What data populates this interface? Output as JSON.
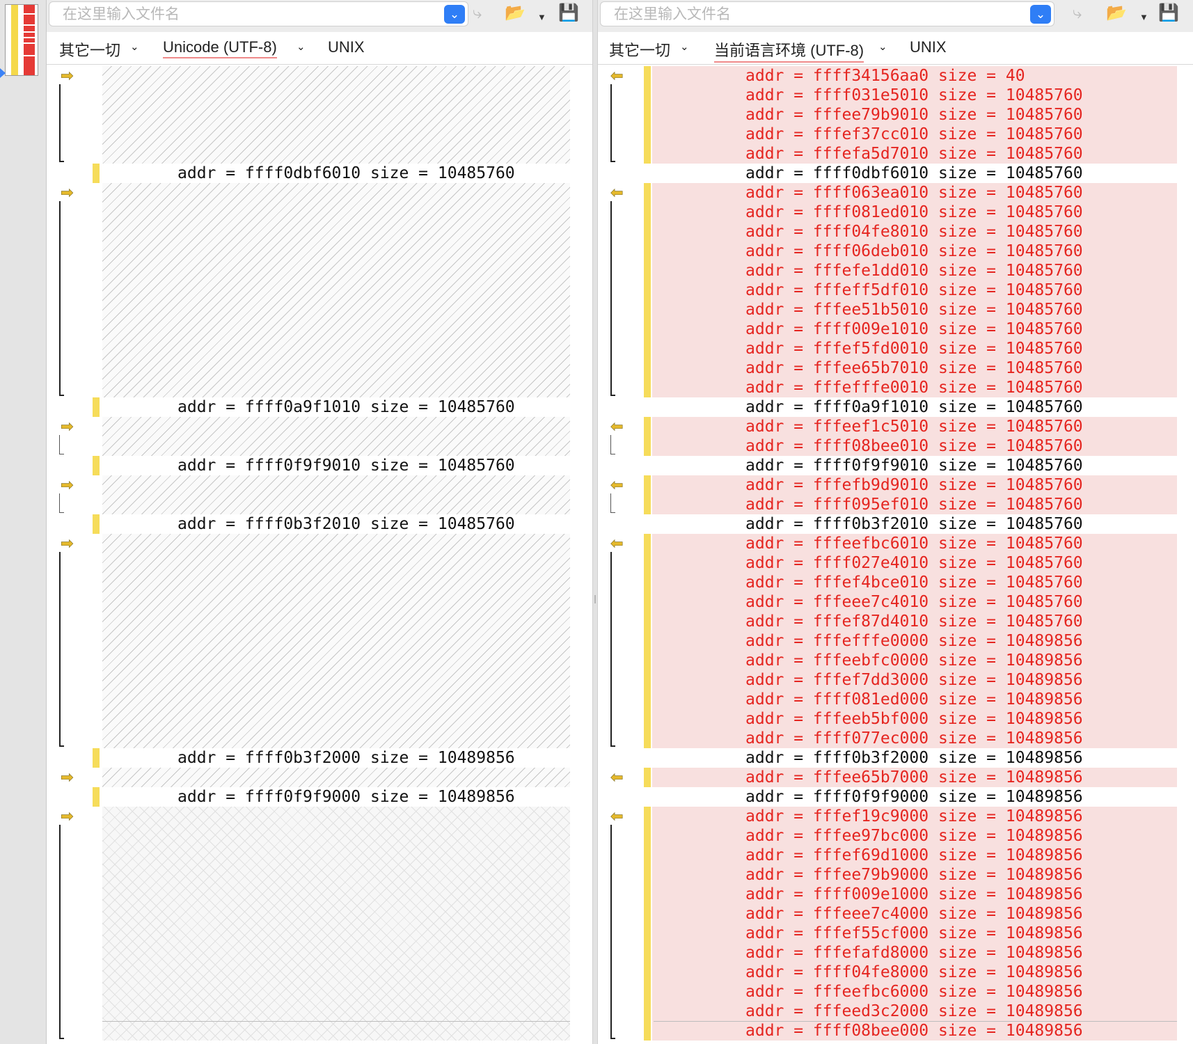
{
  "overview": {
    "label": "diff-overview"
  },
  "left": {
    "filename_placeholder": "在这里输入文件名",
    "info": {
      "file_type": "其它一切",
      "encoding": "Unicode (UTF-8)",
      "line_endings": "UNIX"
    }
  },
  "right": {
    "filename_placeholder": "在这里输入文件名",
    "info": {
      "file_type": "其它一切",
      "encoding": "当前语言环境 (UTF-8)",
      "line_endings": "UNIX"
    }
  },
  "icons": {
    "dropdown": "chevron-down-icon",
    "apply": "apply-merge-icon",
    "folder": "folder-open-icon",
    "save": "save-icon",
    "arrow_right": "copy-to-right-arrow-icon",
    "arrow_left": "copy-to-left-arrow-icon"
  },
  "colors": {
    "changed_text": "#e52520",
    "changed_bg": "#f8e0df",
    "change_marker": "#f6dc5a",
    "accent": "#2f7ef6"
  },
  "right_lines": [
    {
      "addr": "ffff34156aa0",
      "size": "40",
      "status": "changed"
    },
    {
      "addr": "ffff031e5010",
      "size": "10485760",
      "status": "changed"
    },
    {
      "addr": "fffee79b9010",
      "size": "10485760",
      "status": "changed"
    },
    {
      "addr": "fffef37cc010",
      "size": "10485760",
      "status": "changed"
    },
    {
      "addr": "fffefa5d7010",
      "size": "10485760",
      "status": "changed"
    },
    {
      "addr": "ffff0dbf6010",
      "size": "10485760",
      "status": "common"
    },
    {
      "addr": "ffff063ea010",
      "size": "10485760",
      "status": "changed"
    },
    {
      "addr": "ffff081ed010",
      "size": "10485760",
      "status": "changed"
    },
    {
      "addr": "ffff04fe8010",
      "size": "10485760",
      "status": "changed"
    },
    {
      "addr": "ffff06deb010",
      "size": "10485760",
      "status": "changed"
    },
    {
      "addr": "fffefe1dd010",
      "size": "10485760",
      "status": "changed"
    },
    {
      "addr": "fffeff5df010",
      "size": "10485760",
      "status": "changed"
    },
    {
      "addr": "fffee51b5010",
      "size": "10485760",
      "status": "changed"
    },
    {
      "addr": "ffff009e1010",
      "size": "10485760",
      "status": "changed"
    },
    {
      "addr": "fffef5fd0010",
      "size": "10485760",
      "status": "changed"
    },
    {
      "addr": "fffee65b7010",
      "size": "10485760",
      "status": "changed"
    },
    {
      "addr": "fffefffe0010",
      "size": "10485760",
      "status": "changed"
    },
    {
      "addr": "ffff0a9f1010",
      "size": "10485760",
      "status": "common"
    },
    {
      "addr": "fffeef1c5010",
      "size": "10485760",
      "status": "changed"
    },
    {
      "addr": "ffff08bee010",
      "size": "10485760",
      "status": "changed"
    },
    {
      "addr": "ffff0f9f9010",
      "size": "10485760",
      "status": "common"
    },
    {
      "addr": "fffefb9d9010",
      "size": "10485760",
      "status": "changed"
    },
    {
      "addr": "ffff095ef010",
      "size": "10485760",
      "status": "changed"
    },
    {
      "addr": "ffff0b3f2010",
      "size": "10485760",
      "status": "common"
    },
    {
      "addr": "fffeefbc6010",
      "size": "10485760",
      "status": "changed"
    },
    {
      "addr": "ffff027e4010",
      "size": "10485760",
      "status": "changed"
    },
    {
      "addr": "fffef4bce010",
      "size": "10485760",
      "status": "changed"
    },
    {
      "addr": "fffeee7c4010",
      "size": "10485760",
      "status": "changed"
    },
    {
      "addr": "fffef87d4010",
      "size": "10485760",
      "status": "changed"
    },
    {
      "addr": "fffefffe0000",
      "size": "10489856",
      "status": "changed"
    },
    {
      "addr": "fffeebfc0000",
      "size": "10489856",
      "status": "changed"
    },
    {
      "addr": "fffef7dd3000",
      "size": "10489856",
      "status": "changed"
    },
    {
      "addr": "ffff081ed000",
      "size": "10489856",
      "status": "changed"
    },
    {
      "addr": "fffeeb5bf000",
      "size": "10489856",
      "status": "changed"
    },
    {
      "addr": "ffff077ec000",
      "size": "10489856",
      "status": "changed"
    },
    {
      "addr": "ffff0b3f2000",
      "size": "10489856",
      "status": "common"
    },
    {
      "addr": "fffee65b7000",
      "size": "10489856",
      "status": "changed"
    },
    {
      "addr": "ffff0f9f9000",
      "size": "10489856",
      "status": "common"
    },
    {
      "addr": "fffef19c9000",
      "size": "10489856",
      "status": "changed"
    },
    {
      "addr": "fffee97bc000",
      "size": "10489856",
      "status": "changed"
    },
    {
      "addr": "fffef69d1000",
      "size": "10489856",
      "status": "changed"
    },
    {
      "addr": "fffee79b9000",
      "size": "10489856",
      "status": "changed"
    },
    {
      "addr": "ffff009e1000",
      "size": "10489856",
      "status": "changed"
    },
    {
      "addr": "fffeee7c4000",
      "size": "10489856",
      "status": "changed"
    },
    {
      "addr": "fffef55cf000",
      "size": "10489856",
      "status": "changed"
    },
    {
      "addr": "fffefafd8000",
      "size": "10489856",
      "status": "changed"
    },
    {
      "addr": "ffff04fe8000",
      "size": "10489856",
      "status": "changed"
    },
    {
      "addr": "fffeefbc6000",
      "size": "10489856",
      "status": "changed"
    },
    {
      "addr": "fffeed3c2000",
      "size": "10489856",
      "status": "changed"
    },
    {
      "addr": "ffff08bee000",
      "size": "10489856",
      "status": "changed"
    }
  ]
}
